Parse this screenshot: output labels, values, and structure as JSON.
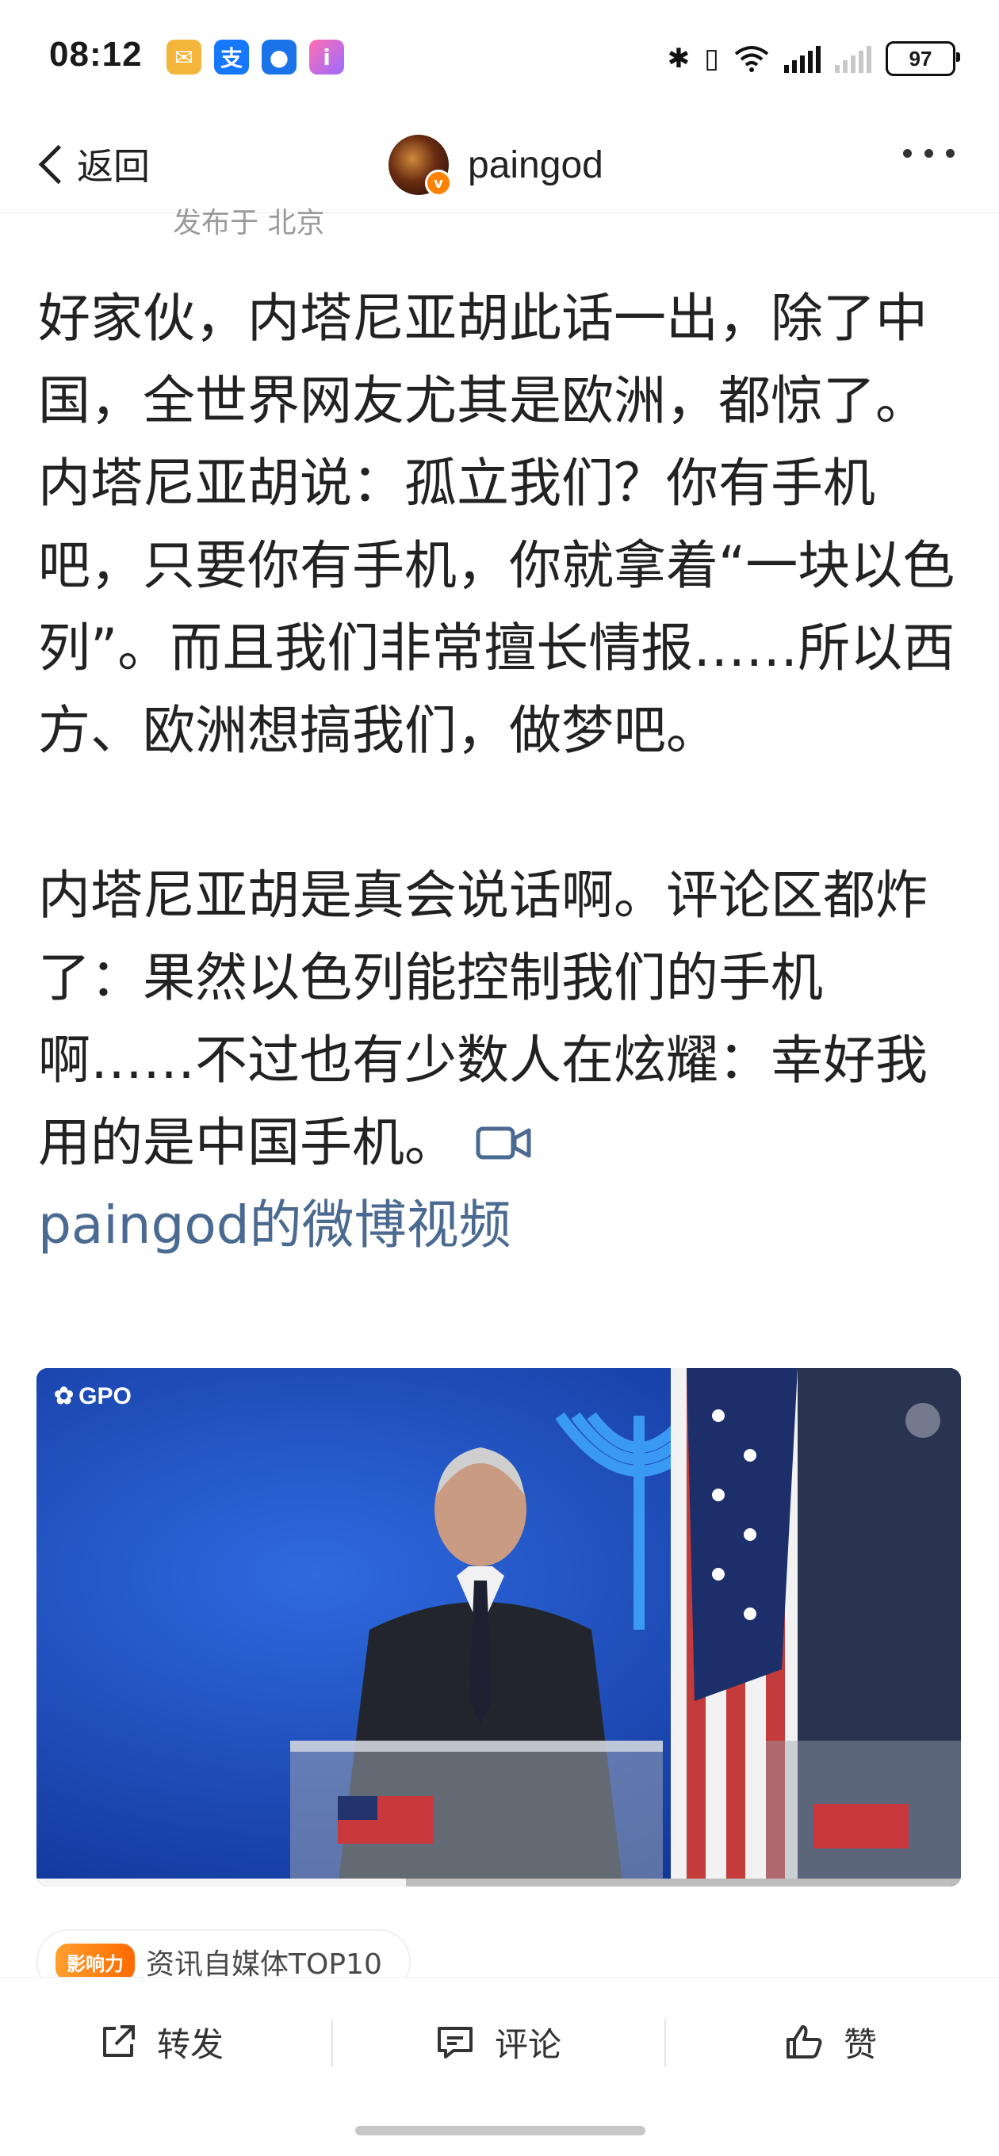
{
  "status_bar": {
    "time": "08:12",
    "battery": "97",
    "app_icons": [
      "mail-icon",
      "alipay-icon",
      "shield-icon",
      "info-icon"
    ],
    "system_icons": [
      "bluetooth-icon",
      "vibrate-icon",
      "wifi-icon",
      "signal-icon",
      "signal-icon"
    ]
  },
  "nav": {
    "back_label": "返回",
    "username": "paingod"
  },
  "post": {
    "location": "发布于 北京",
    "paragraph1": "好家伙，内塔尼亚胡此话一出，除了中国，全世界网友尤其是欧洲，都惊了。内塔尼亚胡说：孤立我们？你有手机吧，只要你有手机，你就拿着“一块以色列”。而且我们非常擅长情报……所以西方、欧洲想搞我们，做梦吧。",
    "paragraph2": "内塔尼亚胡是真会说话啊。评论区都炸了：果然以色列能控制我们的手机啊……不过也有少数人在炫耀：幸好我用的是中国手机。",
    "video_source": "paingod的微博视频",
    "video_watermark": "GPO"
  },
  "influence": {
    "badge": "影响力",
    "text": "资讯自媒体TOP10"
  },
  "actions": {
    "repost": "转发",
    "comment": "评论",
    "like": "赞"
  },
  "colors": {
    "link": "#4b6a92",
    "accent": "#ff8200"
  }
}
